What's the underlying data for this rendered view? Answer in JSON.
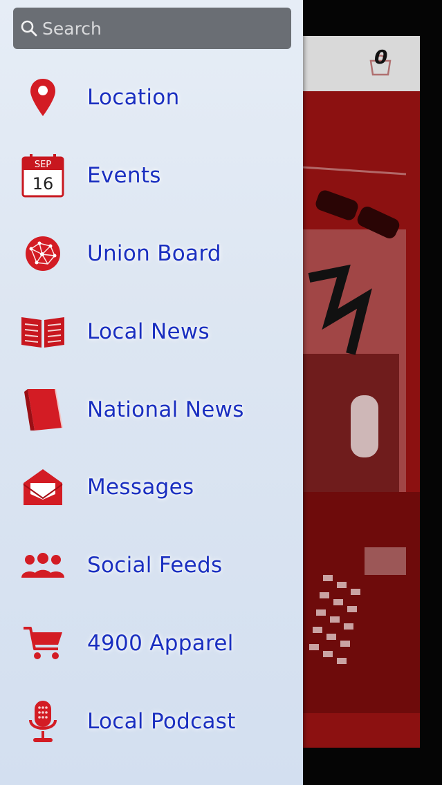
{
  "search": {
    "placeholder": "Search"
  },
  "menu": {
    "items": [
      {
        "label": "Location",
        "icon": "map-pin-icon"
      },
      {
        "label": "Events",
        "icon": "calendar-icon",
        "calendar_month": "SEP",
        "calendar_day": "16"
      },
      {
        "label": "Union Board",
        "icon": "network-globe-icon"
      },
      {
        "label": "Local News",
        "icon": "open-book-icon"
      },
      {
        "label": "National News",
        "icon": "closed-book-icon"
      },
      {
        "label": "Messages",
        "icon": "envelope-icon"
      },
      {
        "label": "Social Feeds",
        "icon": "people-group-icon"
      },
      {
        "label": "4900 Apparel",
        "icon": "shopping-cart-icon"
      },
      {
        "label": "Local Podcast",
        "icon": "microphone-icon"
      }
    ]
  },
  "app": {
    "cart_count": "0"
  },
  "colors": {
    "accent_red": "#d31c24",
    "label_blue": "#1a2fc0",
    "drawer_bg": "#dde6f2",
    "search_bg": "#6a6e74"
  }
}
